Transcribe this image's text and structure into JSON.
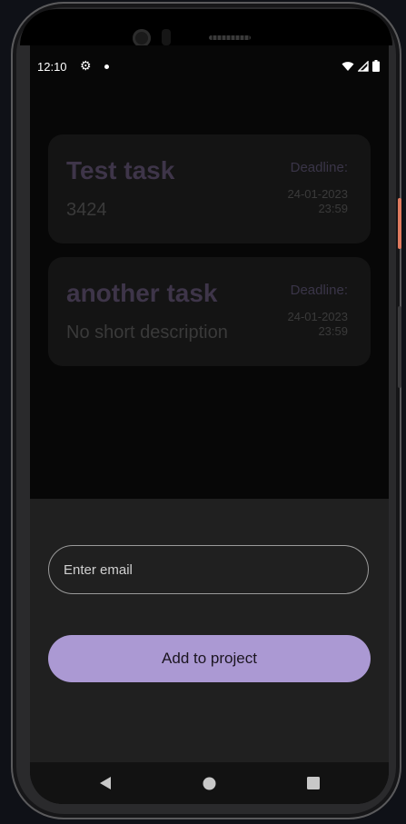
{
  "status_bar": {
    "time": "12:10",
    "settings_icon": "gear-icon",
    "wifi_icon": "wifi-icon",
    "signal_icon": "signal-icon",
    "battery_icon": "battery-icon"
  },
  "tasks": [
    {
      "title": "Test task",
      "description": "3424",
      "deadline_label": "Deadline:",
      "deadline_date": "24-01-2023",
      "deadline_time": "23:59"
    },
    {
      "title": "another task",
      "description": "No short description",
      "deadline_label": "Deadline:",
      "deadline_date": "24-01-2023",
      "deadline_time": "23:59"
    }
  ],
  "sheet": {
    "email_placeholder": "Enter email",
    "email_value": "",
    "add_button_label": "Add to project"
  },
  "nav": {
    "back_icon": "back-triangle-icon",
    "home_icon": "home-circle-icon",
    "recents_icon": "recents-square-icon"
  },
  "colors": {
    "accent": "#ab99d3",
    "sheet_background": "#202020",
    "screen_background": "#070707"
  }
}
